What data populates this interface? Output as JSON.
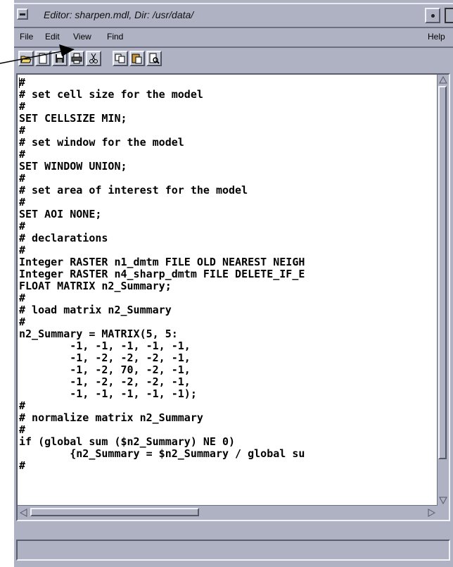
{
  "window": {
    "title": "Editor: sharpen.mdl, Dir: /usr/data/"
  },
  "menubar": {
    "file": "File",
    "edit": "Edit",
    "view": "View",
    "find": "Find",
    "help": "Help"
  },
  "toolbar": {
    "buttons": [
      "open-icon",
      "new-icon",
      "save-icon",
      "print-icon",
      "cut-icon",
      "copy-icon",
      "paste-icon",
      "find-icon"
    ]
  },
  "editor": {
    "lines": [
      "#",
      "# set cell size for the model",
      "#",
      "SET CELLSIZE MIN;",
      "#",
      "# set window for the model",
      "#",
      "SET WINDOW UNION;",
      "#",
      "# set area of interest for the model",
      "#",
      "SET AOI NONE;",
      "#",
      "# declarations",
      "#",
      "Integer RASTER n1_dmtm FILE OLD NEAREST NEIGH",
      "Integer RASTER n4_sharp_dmtm FILE DELETE_IF_E",
      "FLOAT MATRIX n2_Summary;",
      "#",
      "# load matrix n2_Summary",
      "#",
      "n2_Summary = MATRIX(5, 5:",
      "        -1, -1, -1, -1, -1,",
      "        -1, -2, -2, -2, -1,",
      "        -1, -2, 70, -2, -1,",
      "        -1, -2, -2, -2, -1,",
      "        -1, -1, -1, -1, -1);",
      "#",
      "# normalize matrix n2_Summary",
      "#",
      "if (global sum ($n2_Summary) NE 0)",
      "        {n2_Summary = $n2_Summary / global su",
      "#"
    ]
  },
  "statusbar": {
    "text": ""
  },
  "colors": {
    "window_bg": "#aeb2c3",
    "text_bg": "#ffffff"
  }
}
